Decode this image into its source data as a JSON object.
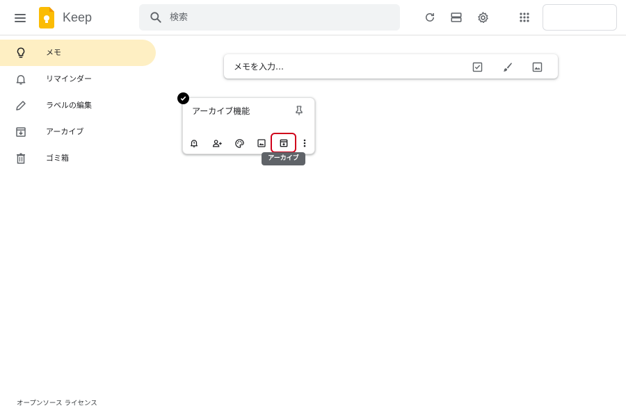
{
  "header": {
    "app_name": "Keep",
    "search_placeholder": "検索",
    "icons": [
      "menu-icon",
      "keep-logo",
      "search-icon",
      "refresh-icon",
      "list-view-icon",
      "settings-icon",
      "apps-icon"
    ]
  },
  "sidebar": {
    "items": [
      {
        "label": "メモ",
        "icon": "lightbulb-icon",
        "active": true
      },
      {
        "label": "リマインダー",
        "icon": "bell-icon",
        "active": false
      },
      {
        "label": "ラベルの編集",
        "icon": "pencil-icon",
        "active": false
      },
      {
        "label": "アーカイブ",
        "icon": "archive-icon",
        "active": false
      },
      {
        "label": "ゴミ箱",
        "icon": "trash-icon",
        "active": false
      }
    ],
    "footer_link": "オープンソース ライセンス"
  },
  "take_note": {
    "placeholder": "メモを入力…",
    "icons": [
      "checkbox-icon",
      "brush-icon",
      "image-icon"
    ]
  },
  "note": {
    "title": "アーカイブ機能",
    "selected": true,
    "toolbar_icons": [
      "reminder-icon",
      "collaborator-icon",
      "palette-icon",
      "image-icon",
      "archive-icon",
      "more-icon"
    ],
    "tooltip": "アーカイブ"
  },
  "colors": {
    "active_nav": "#feefc3",
    "highlight": "#d0021b",
    "logo": "#fbbc04"
  }
}
